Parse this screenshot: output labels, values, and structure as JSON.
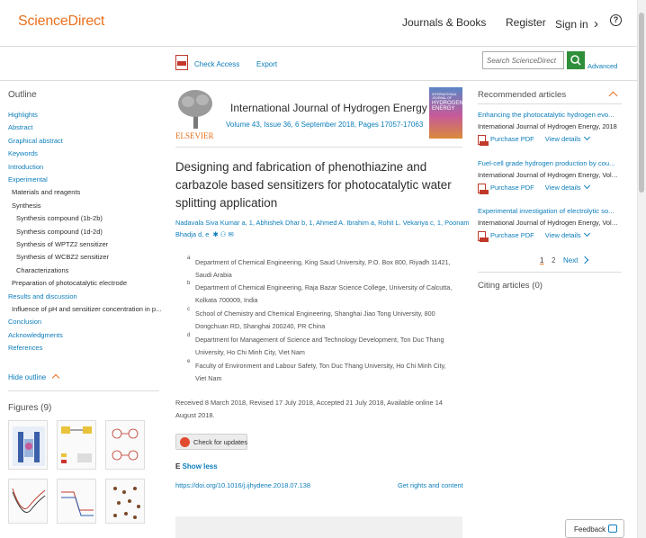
{
  "header": {
    "logo": "ScienceDirect",
    "journals_books": "Journals & Books",
    "register": "Register",
    "sign_in": "Sign in",
    "sign_in_chevron": "›",
    "help_symbol": "?"
  },
  "toolbar": {
    "check_access": "Check Access",
    "export": "Export",
    "search_placeholder": "Search ScienceDirect",
    "advanced": "Advanced"
  },
  "outline": {
    "heading": "Outline",
    "items": [
      "Highlights",
      "Abstract",
      "Graphical abstract",
      "Keywords",
      "Introduction",
      "Experimental",
      "Materials and reagents",
      "Synthesis",
      "Synthesis compound (1b-2b)",
      "Synthesis compound (1d-2d)",
      "Synthesis of WPTZ2 sensitizer",
      "Synthesis of WCBZ2 sensitizer",
      "Characterizations",
      "Preparation of photocatalytic electrode",
      "Results and discussion",
      "Influence of pH and sensitizer concentration in p...",
      "Conclusion",
      "Acknowledgments",
      "References"
    ],
    "hide_outline": "Hide outline",
    "figures_heading": "Figures (9)"
  },
  "article": {
    "publisher": "ELSEVIER",
    "journal": "International Journal of Hydrogen Energy",
    "issue_info": "Volume 43, Issue 36, 6 September 2018, Pages 17057-17063",
    "cover_text_1": "INTERNATIONAL JOURNAL OF",
    "cover_text_2": "HYDROGEN",
    "cover_text_3": "ENERGY",
    "title_line_1": "Designing and fabrication of phenothiazine and",
    "title_line_2": "carbazole based sensitizers for photocatalytic water",
    "title_line_3": "splitting application",
    "authors_line_1": "Nadavala Siva Kumar a, 1, Abhishek Dhar b, 1, Ahmed A. Ibrahim a, Rohit L. Vekariya c, 1, Poonam",
    "authors_line_2": "Bhadja d, e",
    "affiliations": [
      {
        "sup": "a",
        "l1": "Department of Chemical Engineering, King Saud University, P.O. Box 800, Riyadh 11421,",
        "l2": "Saudi Arabia"
      },
      {
        "sup": "b",
        "l1": "Department of Chemical Engineering, Raja Bazar Science College, University of Calcutta,",
        "l2": "Kolkata 700009, India"
      },
      {
        "sup": "c",
        "l1": "School of Chemistry and Chemical Engineering, Shanghai Jiao Tong University, 800",
        "l2": "Dongchuan RD, Shanghai 200240, PR China"
      },
      {
        "sup": "d",
        "l1": "Department for Management of Science and Technology Development, Ton Duc Thang",
        "l2": "University, Ho Chi Minh City, Viet Nam"
      },
      {
        "sup": "e",
        "l1": "Faculty of Environment and Labour Safety, Ton Duc Thang University, Ho Chi Minh City,",
        "l2": "Viet Nam"
      }
    ],
    "dates_line_1": "Received 8 March 2018, Revised 17 July 2018, Accepted 21 July 2018, Available online 14",
    "dates_line_2": "August 2018.",
    "check_updates": "Check for updates",
    "show_less": "Show less",
    "doi": "https://doi.org/10.1016/j.ijhydene.2018.07.138",
    "rights": "Get rights and content"
  },
  "recommended": {
    "heading": "Recommended articles",
    "items": [
      {
        "title": "Enhancing the photocatalytic hydrogen evo...",
        "source": "International Journal of Hydrogen Energy, 2018"
      },
      {
        "title": "Fuel-cell grade hydrogen production by cou...",
        "source": "International Journal of Hydrogen Energy, Volu..."
      },
      {
        "title": "Experimental investigation of electrolytic so...",
        "source": "International Journal of Hydrogen Energy, Volu..."
      }
    ],
    "purchase_pdf": "Purchase PDF",
    "view_details": "View details",
    "pagination": {
      "page1": "1",
      "page2": "2",
      "next": "Next"
    },
    "citing": "Citing articles (0)"
  },
  "feedback": "Feedback"
}
